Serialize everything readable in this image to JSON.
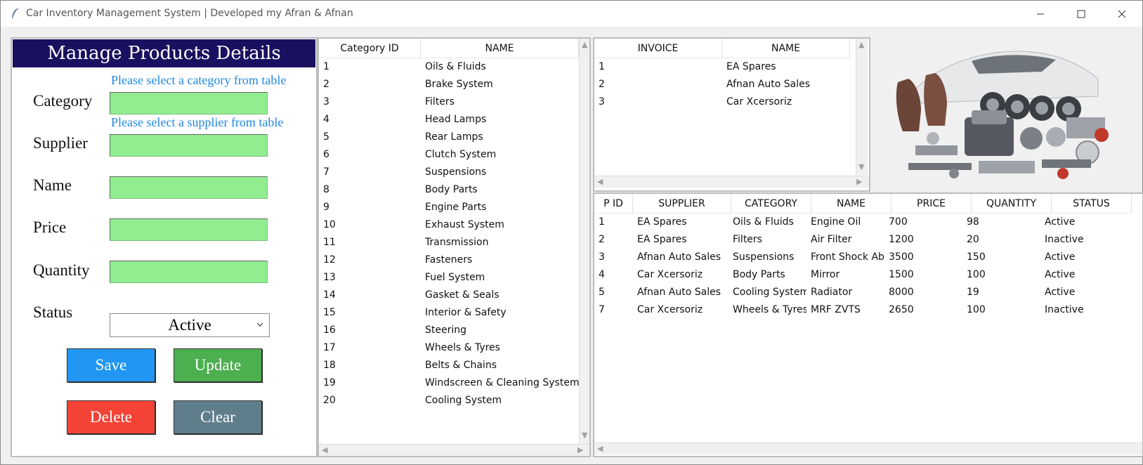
{
  "window": {
    "title": "Car Inventory Management System | Developed my Afran & Afnan",
    "controls": {
      "minimize": "minimize-icon",
      "maximize": "maximize-icon",
      "close": "close-icon"
    }
  },
  "form": {
    "header": "Manage Products Details",
    "category_hint": "Please select a category from table",
    "supplier_hint": "Please select a supplier from table",
    "labels": {
      "category": "Category",
      "supplier": "Supplier",
      "name": "Name",
      "price": "Price",
      "quantity": "Quantity",
      "status": "Status"
    },
    "values": {
      "category": "",
      "supplier": "",
      "name": "",
      "price": "",
      "quantity": ""
    },
    "status_selected": "Active",
    "buttons": {
      "save": "Save",
      "update": "Update",
      "delete": "Delete",
      "clear": "Clear"
    },
    "colors": {
      "header_bg": "#1a1060",
      "input_bg": "#90ee90",
      "hint": "#1e88e5",
      "save": "#2196f3",
      "update": "#4caf50",
      "delete": "#f44336",
      "clear": "#607d8b"
    }
  },
  "category_table": {
    "headers": [
      "Category ID",
      "NAME"
    ],
    "rows": [
      [
        "1",
        "Oils & Fluids"
      ],
      [
        "2",
        "Brake System"
      ],
      [
        "3",
        "Filters"
      ],
      [
        "4",
        "Head Lamps"
      ],
      [
        "5",
        "Rear Lamps"
      ],
      [
        "6",
        "Clutch System"
      ],
      [
        "7",
        "Suspensions"
      ],
      [
        "8",
        "Body Parts"
      ],
      [
        "9",
        "Engine Parts"
      ],
      [
        "10",
        "Exhaust System"
      ],
      [
        "11",
        "Transmission"
      ],
      [
        "12",
        "Fasteners"
      ],
      [
        "13",
        "Fuel System"
      ],
      [
        "14",
        "Gasket & Seals"
      ],
      [
        "15",
        "Interior & Safety"
      ],
      [
        "16",
        "Steering"
      ],
      [
        "17",
        "Wheels & Tyres"
      ],
      [
        "18",
        "Belts & Chains"
      ],
      [
        "19",
        "Windscreen & Cleaning System"
      ],
      [
        "20",
        "Cooling System"
      ]
    ]
  },
  "supplier_table": {
    "headers": [
      "INVOICE",
      "NAME"
    ],
    "rows": [
      [
        "1",
        "EA Spares"
      ],
      [
        "2",
        "Afnan Auto Sales"
      ],
      [
        "3",
        "Car Xcersoriz"
      ]
    ]
  },
  "product_table": {
    "headers": [
      "P ID",
      "SUPPLIER",
      "CATEGORY",
      "NAME",
      "PRICE",
      "QUANTITY",
      "STATUS"
    ],
    "rows": [
      [
        "1",
        "EA Spares",
        "Oils & Fluids",
        "Engine Oil",
        "700",
        "98",
        "Active"
      ],
      [
        "2",
        "EA Spares",
        "Filters",
        "Air Filter",
        "1200",
        "20",
        "Inactive"
      ],
      [
        "3",
        "Afnan Auto Sales",
        "Suspensions",
        "Front Shock Abs",
        "3500",
        "150",
        "Active"
      ],
      [
        "4",
        "Car Xcersoriz",
        "Body Parts",
        "Mirror",
        "1500",
        "100",
        "Active"
      ],
      [
        "5",
        "Afnan Auto Sales",
        "Cooling System",
        "Radiator",
        "8000",
        "19",
        "Active"
      ],
      [
        "7",
        "Car Xcersoriz",
        "Wheels & Tyres",
        "MRF ZVTS",
        "2650",
        "100",
        "Inactive"
      ]
    ]
  },
  "image": {
    "icon": "car-parts-image"
  }
}
